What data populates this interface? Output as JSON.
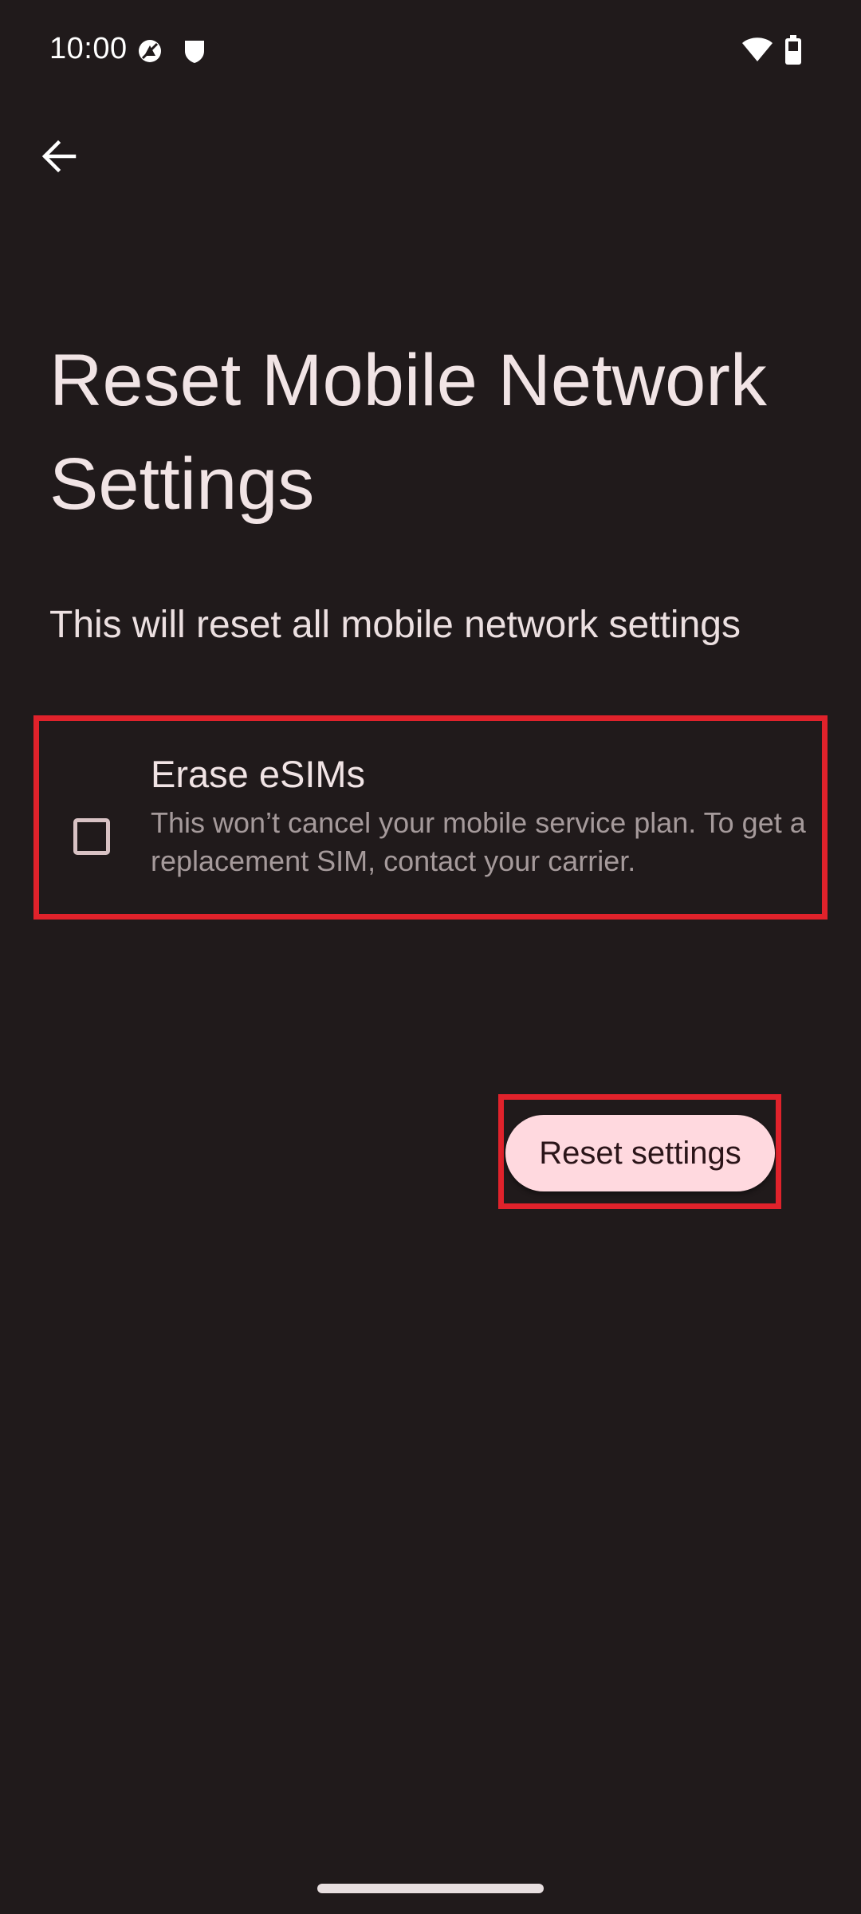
{
  "status_bar": {
    "time": "10:00",
    "icons": [
      "vpn-lock-icon",
      "shield-icon",
      "wifi-icon",
      "battery-icon"
    ]
  },
  "header": {
    "back_icon": "arrow-back-icon"
  },
  "main": {
    "title": "Reset Mobile Network Settings",
    "subtitle": "This will reset all mobile network settings",
    "option": {
      "title": "Erase eSIMs",
      "description": "This won’t cancel your mobile service plan. To get a replacement SIM, contact your carrier.",
      "checked": false
    },
    "reset_button_label": "Reset settings"
  },
  "colors": {
    "background": "#201a1b",
    "button": "#ffd9df",
    "highlight": "#e0222b"
  }
}
